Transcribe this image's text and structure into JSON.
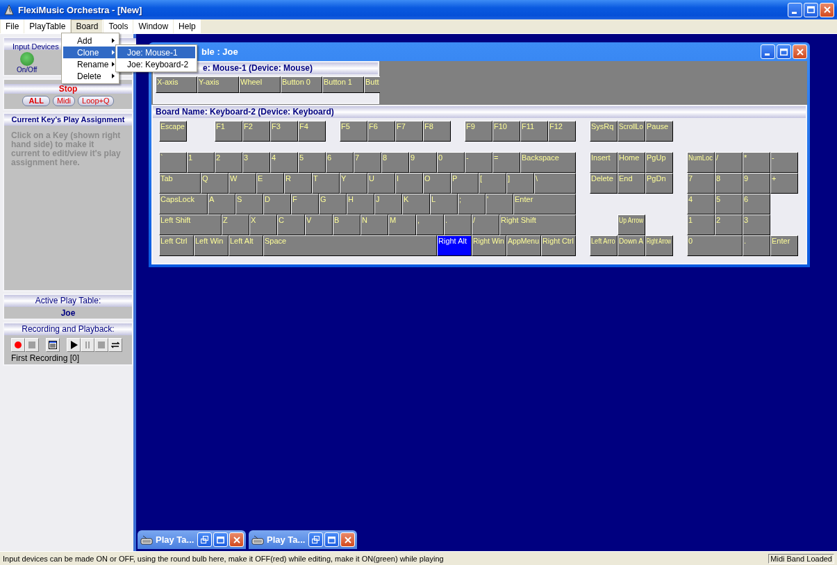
{
  "window": {
    "title": "FlexiMusic Orchestra - [New]"
  },
  "menu_bar": [
    {
      "label": "File",
      "selected": false
    },
    {
      "label": "PlayTable",
      "selected": false
    },
    {
      "label": "Board",
      "selected": true
    },
    {
      "label": "Tools",
      "selected": false
    },
    {
      "label": "Window",
      "selected": false
    },
    {
      "label": "Help",
      "selected": false
    }
  ],
  "board_menu": [
    {
      "label": "Add",
      "selected": false
    },
    {
      "label": "Clone",
      "selected": true
    },
    {
      "label": "Rename",
      "selected": false
    },
    {
      "label": "Delete",
      "selected": false
    }
  ],
  "clone_submenu": [
    {
      "label": "Joe: Mouse-1",
      "selected": true
    },
    {
      "label": "Joe: Keyboard-2",
      "selected": false
    }
  ],
  "left_panel": {
    "input_devices": {
      "title": "Input Devices",
      "bulb_on": true,
      "bulb_label": "On/Off"
    },
    "stop": {
      "title": "Stop",
      "buttons": [
        {
          "label": "ALL",
          "kind": "primary"
        },
        {
          "label": "Midi",
          "kind": "normal"
        },
        {
          "label": "Loop+Q",
          "kind": "normal"
        }
      ]
    },
    "key_assignment": {
      "title": "Current Key's Play Assignment",
      "hint": "Click on a Key (shown right hand side) to make it current to edit/view it's play assignment here."
    },
    "active_play_table": {
      "title": "Active Play Table:",
      "value": "Joe"
    },
    "recording": {
      "title": "Recording and Playback:",
      "buttons": [
        {
          "kind": "record",
          "disabled": false
        },
        {
          "kind": "stop",
          "disabled": true
        },
        {
          "kind": "list",
          "disabled": false
        },
        {
          "kind": "play",
          "disabled": false
        },
        {
          "kind": "pause",
          "disabled": true
        },
        {
          "kind": "stop",
          "disabled": true
        },
        {
          "kind": "loop",
          "disabled": false
        }
      ],
      "recording_name": "First Recording [0]"
    }
  },
  "play_table_window": {
    "title": "ble : Joe",
    "mouse_board": {
      "title": "e: Mouse-1 (Device: Mouse)",
      "keys": [
        "X-axis",
        "Y-axis",
        "Wheel",
        "Button 0",
        "Button 1",
        "Butt"
      ]
    },
    "keyboard_board": {
      "title": "Board Name: Keyboard-2 (Device: Keyboard)",
      "keys": [
        {
          "label": "Escape",
          "selected": false
        },
        {
          "label": "F1",
          "selected": false
        },
        {
          "label": "F2",
          "selected": false
        },
        {
          "label": "F3",
          "selected": false
        },
        {
          "label": "F4",
          "selected": false
        },
        {
          "label": "F5",
          "selected": false
        },
        {
          "label": "F6",
          "selected": false
        },
        {
          "label": "F7",
          "selected": false
        },
        {
          "label": "F8",
          "selected": false
        },
        {
          "label": "F9",
          "selected": false
        },
        {
          "label": "F10",
          "selected": false
        },
        {
          "label": "F11",
          "selected": false
        },
        {
          "label": "F12",
          "selected": false
        },
        {
          "label": "SysRq",
          "selected": false
        },
        {
          "label": "ScrollLo",
          "selected": false
        },
        {
          "label": "Pause",
          "selected": false
        },
        {
          "label": "`",
          "selected": false
        },
        {
          "label": "1",
          "selected": false
        },
        {
          "label": "2",
          "selected": false
        },
        {
          "label": "3",
          "selected": false
        },
        {
          "label": "4",
          "selected": false
        },
        {
          "label": "5",
          "selected": false
        },
        {
          "label": "6",
          "selected": false
        },
        {
          "label": "7",
          "selected": false
        },
        {
          "label": "8",
          "selected": false
        },
        {
          "label": "9",
          "selected": false
        },
        {
          "label": "0",
          "selected": false
        },
        {
          "label": "-",
          "selected": false
        },
        {
          "label": "=",
          "selected": false
        },
        {
          "label": "Backspace",
          "selected": false
        },
        {
          "label": "Insert",
          "selected": false
        },
        {
          "label": "Home",
          "selected": false
        },
        {
          "label": "PgUp",
          "selected": false
        },
        {
          "label": "NumLoc",
          "selected": false
        },
        {
          "label": "/",
          "selected": false
        },
        {
          "label": "*",
          "selected": false
        },
        {
          "label": "-",
          "selected": false
        },
        {
          "label": "Tab",
          "selected": false
        },
        {
          "label": "Q",
          "selected": false
        },
        {
          "label": "W",
          "selected": false
        },
        {
          "label": "E",
          "selected": false
        },
        {
          "label": "R",
          "selected": false
        },
        {
          "label": "T",
          "selected": false
        },
        {
          "label": "Y",
          "selected": false
        },
        {
          "label": "U",
          "selected": false
        },
        {
          "label": "I",
          "selected": false
        },
        {
          "label": "O",
          "selected": false
        },
        {
          "label": "P",
          "selected": false
        },
        {
          "label": "[",
          "selected": false
        },
        {
          "label": "]",
          "selected": false
        },
        {
          "label": "\\",
          "selected": false
        },
        {
          "label": "Delete",
          "selected": false
        },
        {
          "label": "End",
          "selected": false
        },
        {
          "label": "PgDn",
          "selected": false
        },
        {
          "label": "7",
          "selected": false
        },
        {
          "label": "8",
          "selected": false
        },
        {
          "label": "9",
          "selected": false
        },
        {
          "label": "+",
          "selected": false
        },
        {
          "label": "CapsLock",
          "selected": false
        },
        {
          "label": "A",
          "selected": false
        },
        {
          "label": "S",
          "selected": false
        },
        {
          "label": "D",
          "selected": false
        },
        {
          "label": "F",
          "selected": false
        },
        {
          "label": "G",
          "selected": false
        },
        {
          "label": "H",
          "selected": false
        },
        {
          "label": "J",
          "selected": false
        },
        {
          "label": "K",
          "selected": false
        },
        {
          "label": "L",
          "selected": false
        },
        {
          "label": ";",
          "selected": false
        },
        {
          "label": "'",
          "selected": false
        },
        {
          "label": "Enter",
          "selected": false
        },
        {
          "label": "4",
          "selected": false
        },
        {
          "label": "5",
          "selected": false
        },
        {
          "label": "6",
          "selected": false
        },
        {
          "label": "Left Shift",
          "selected": false
        },
        {
          "label": "Z",
          "selected": false
        },
        {
          "label": "X",
          "selected": false
        },
        {
          "label": "C",
          "selected": false
        },
        {
          "label": "V",
          "selected": false
        },
        {
          "label": "B",
          "selected": false
        },
        {
          "label": "N",
          "selected": false
        },
        {
          "label": "M",
          "selected": false
        },
        {
          "label": ",",
          "selected": false
        },
        {
          "label": ".",
          "selected": false
        },
        {
          "label": "/",
          "selected": false
        },
        {
          "label": "Right Shift",
          "selected": false
        },
        {
          "label": "Up Arrow",
          "selected": false
        },
        {
          "label": "1",
          "selected": false
        },
        {
          "label": "2",
          "selected": false
        },
        {
          "label": "3",
          "selected": false
        },
        {
          "label": "Left Ctrl",
          "selected": false
        },
        {
          "label": "Left Win",
          "selected": false
        },
        {
          "label": "Left Alt",
          "selected": false
        },
        {
          "label": "Space",
          "selected": false
        },
        {
          "label": "Right Alt",
          "selected": true
        },
        {
          "label": "Right Win",
          "selected": false
        },
        {
          "label": "AppMenu",
          "selected": false
        },
        {
          "label": "Right Ctrl",
          "selected": false
        },
        {
          "label": "Left Arro",
          "selected": false
        },
        {
          "label": "Down A",
          "selected": false
        },
        {
          "label": "Right Arrow",
          "selected": false
        },
        {
          "label": "0",
          "selected": false
        },
        {
          "label": ".",
          "selected": false
        },
        {
          "label": "Enter",
          "selected": false
        }
      ]
    }
  },
  "minimized_windows": [
    {
      "title": "Play Ta..."
    },
    {
      "title": "Play Ta..."
    }
  ],
  "status_bar": {
    "message": "Input devices can be made ON or OFF, using the round bulb here, make it OFF(red) while editing, make it ON(green) while playing",
    "panel": "Midi Band Loaded"
  }
}
